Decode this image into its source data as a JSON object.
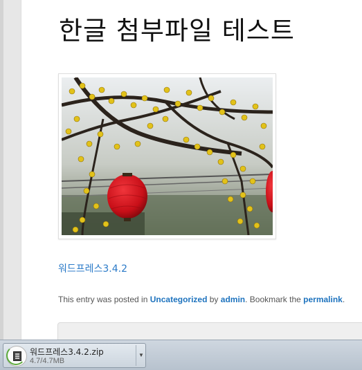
{
  "post": {
    "title": "한글 첨부파일 테스트",
    "attachment_link": "워드프레스3.4.2",
    "meta": {
      "prefix": "This entry was posted in ",
      "category": "Uncategorized",
      "by": " by ",
      "author": "admin",
      "bookmark": ". Bookmark the ",
      "permalink": "permalink",
      "suffix": "."
    }
  },
  "download_bar": {
    "filename": "워드프레스3.4.2.zip",
    "status": "4.7/4.7MB",
    "menu_icon": "chevron-down-icon",
    "file_icon": "zip-file-icon"
  },
  "colors": {
    "link": "#1e73be",
    "lantern": "#d8141c",
    "blossom": "#e2c21a"
  }
}
